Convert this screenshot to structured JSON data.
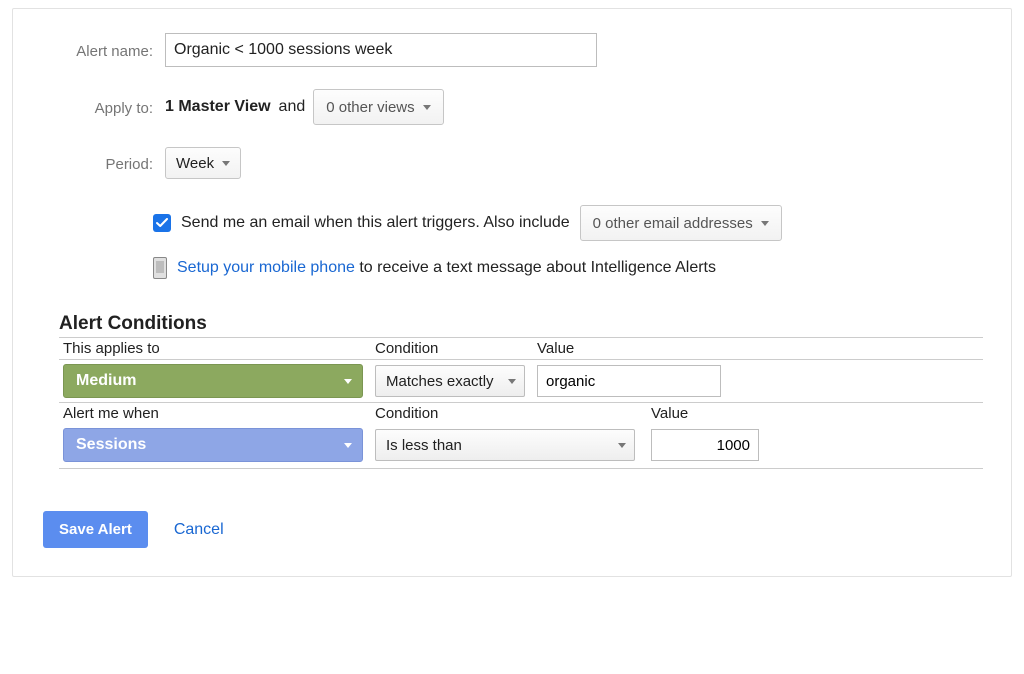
{
  "labels": {
    "alert_name": "Alert name:",
    "apply_to": "Apply to:",
    "period": "Period:"
  },
  "alert_name_value": "Organic < 1000 sessions week",
  "apply_to": {
    "view_text": "1 Master View",
    "and": "and",
    "other_views_dropdown": "0 other views"
  },
  "period_dropdown": "Week",
  "email": {
    "checkbox_text": "Send me an email when this alert triggers. Also include",
    "other_emails_dropdown": "0 other email addresses"
  },
  "mobile": {
    "link_text": "Setup your mobile phone",
    "rest_text": " to receive a text message about Intelligence Alerts"
  },
  "conditions": {
    "title": "Alert Conditions",
    "applies_to_label": "This applies to",
    "condition_label": "Condition",
    "value_label": "Value",
    "alert_me_label": "Alert me when",
    "dimension": "Medium",
    "dim_condition": "Matches exactly",
    "dim_value": "organic",
    "metric": "Sessions",
    "met_condition": "Is less than",
    "met_value": "1000"
  },
  "actions": {
    "save": "Save Alert",
    "cancel": "Cancel"
  }
}
